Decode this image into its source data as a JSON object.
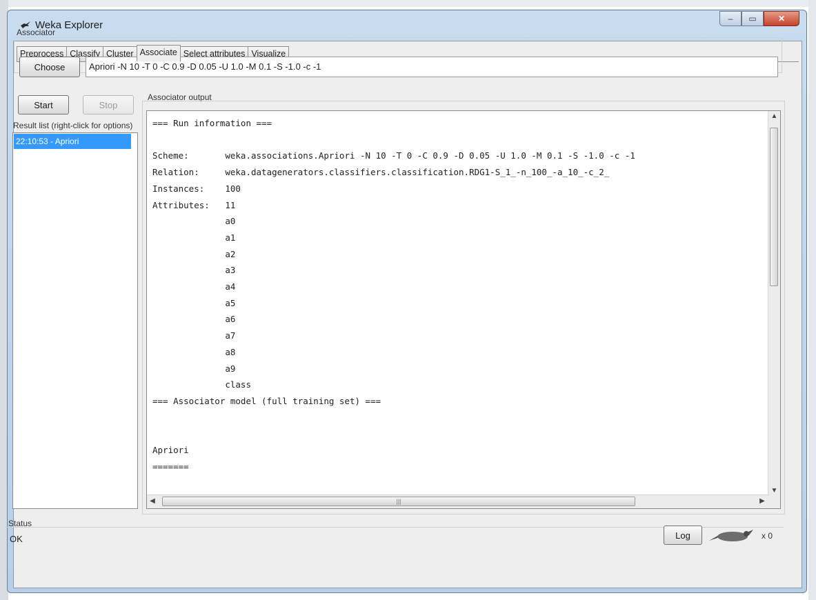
{
  "window": {
    "title": "Weka Explorer",
    "controls": {
      "minimize": "‒",
      "maximize": "▭",
      "close": "✕"
    }
  },
  "tabs": [
    "Preprocess",
    "Classify",
    "Cluster",
    "Associate",
    "Select attributes",
    "Visualize"
  ],
  "active_tab": "Associate",
  "associator": {
    "label": "Associator",
    "choose_label": "Choose",
    "scheme": "Apriori -N 10 -T 0 -C 0.9 -D 0.05 -U 1.0 -M 0.1 -S -1.0 -c -1"
  },
  "controls": {
    "start_label": "Start",
    "stop_label": "Stop"
  },
  "result_list": {
    "label": "Result list (right-click for options)",
    "items": [
      "22:10:53 - Apriori"
    ]
  },
  "output": {
    "label": "Associator output",
    "text": "=== Run information ===\n\nScheme:       weka.associations.Apriori -N 10 -T 0 -C 0.9 -D 0.05 -U 1.0 -M 0.1 -S -1.0 -c -1\nRelation:     weka.datagenerators.classifiers.classification.RDG1-S_1_-n_100_-a_10_-c_2_\nInstances:    100\nAttributes:   11\n              a0\n              a1\n              a2\n              a3\n              a4\n              a5\n              a6\n              a7\n              a8\n              a9\n              class\n=== Associator model (full training set) ===\n\n\nApriori\n======="
  },
  "status": {
    "label": "Status",
    "text": "OK",
    "log_label": "Log",
    "count": "x 0"
  },
  "icons": {
    "app": "weka-bird-icon",
    "status": "weka-bird-status-icon"
  }
}
